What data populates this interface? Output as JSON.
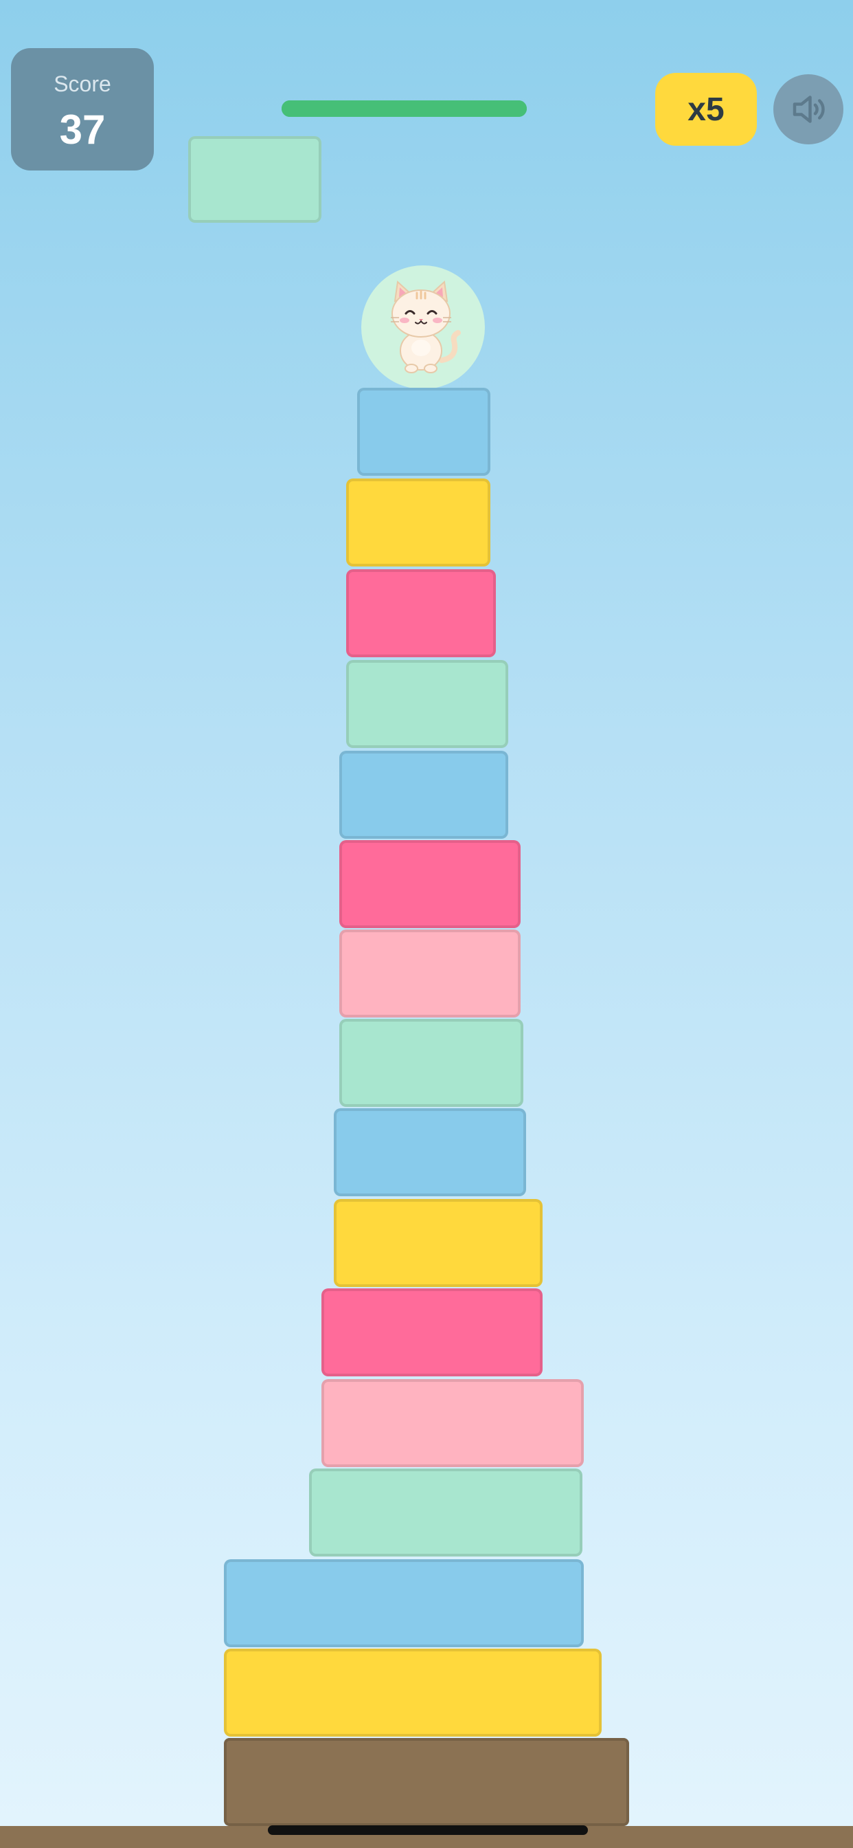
{
  "hud": {
    "score_label": "Score",
    "score_value": "37",
    "multiplier": "x5",
    "progress_fraction": 1.0
  },
  "icons": {
    "sound": "speaker-volume-icon",
    "character": "cat-icon"
  },
  "colors": {
    "sky_top": "#8ecfec",
    "sky_bottom": "#e3f4fd",
    "blue": "#88cbeb",
    "yellow": "#ffd93d",
    "pink": "#ff6b9a",
    "light_pink": "#ffb3c0",
    "mint": "#a8e6cf",
    "base": "#8b7253",
    "accent_green": "#46bf77"
  },
  "falling_block": {
    "color": "mint"
  },
  "tower_blocks_top_to_bottom": [
    "blue",
    "yellow",
    "pink",
    "mint",
    "blue",
    "pink",
    "light_pink",
    "mint",
    "blue",
    "yellow",
    "pink",
    "light_pink",
    "mint",
    "blue",
    "yellow"
  ]
}
